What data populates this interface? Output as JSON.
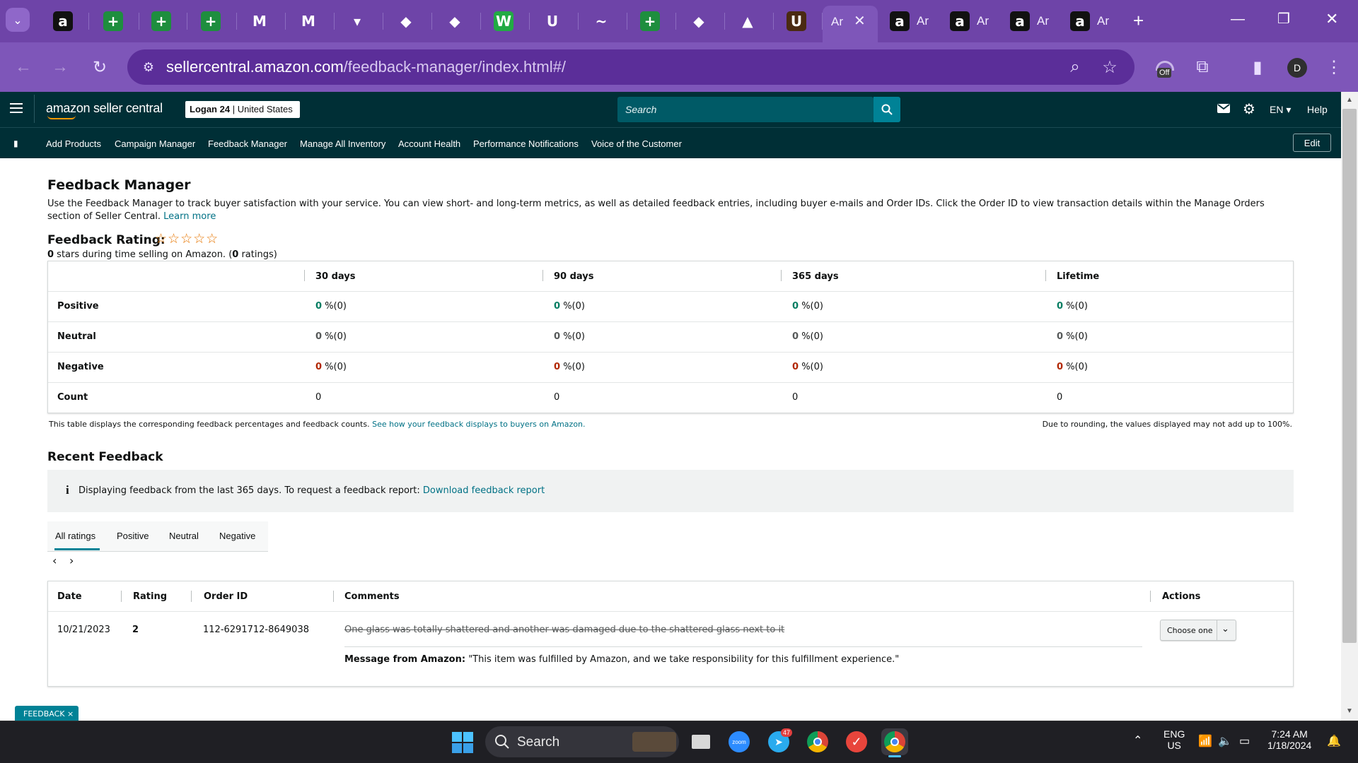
{
  "browser": {
    "tabs": [
      {
        "icon": "amazon-icon",
        "glyph": "a",
        "bg": "#111111"
      },
      {
        "icon": "sheets-plus-icon",
        "glyph": "+",
        "bg": "#1e8e3e"
      },
      {
        "icon": "sheets-plus-icon",
        "glyph": "+",
        "bg": "#1e8e3e"
      },
      {
        "icon": "sheets-plus-icon",
        "glyph": "+",
        "bg": "#1e8e3e"
      },
      {
        "icon": "gmail-icon",
        "glyph": "M",
        "bg": "#6e44a8"
      },
      {
        "icon": "gmail-icon",
        "glyph": "M",
        "bg": "#6e44a8"
      },
      {
        "icon": "site-icon",
        "glyph": "▾",
        "bg": "#6e44a8"
      },
      {
        "icon": "tool-icon",
        "glyph": "◆",
        "bg": "#6e44a8"
      },
      {
        "icon": "tool-icon",
        "glyph": "◆",
        "bg": "#6e44a8"
      },
      {
        "icon": "w-app-icon",
        "glyph": "W",
        "bg": "#22aa44"
      },
      {
        "icon": "uline-icon",
        "glyph": "U",
        "bg": "#6e44a8"
      },
      {
        "icon": "site-icon",
        "glyph": "~",
        "bg": "#6e44a8"
      },
      {
        "icon": "sheets-plus-icon",
        "glyph": "+",
        "bg": "#1e8e3e"
      },
      {
        "icon": "tool-icon",
        "glyph": "◆",
        "bg": "#6e44a8"
      },
      {
        "icon": "drive-icon",
        "glyph": "▲",
        "bg": "#6e44a8"
      },
      {
        "icon": "ups-icon",
        "glyph": "U",
        "bg": "#4a2a12"
      }
    ],
    "active_tab_label": "Ar",
    "extra_tabs": [
      {
        "glyph": "a",
        "label": "Ar"
      },
      {
        "glyph": "a",
        "label": "Ar"
      },
      {
        "glyph": "a",
        "label": "Ar"
      },
      {
        "glyph": "a",
        "label": "Ar"
      }
    ],
    "url_host": "sellercentral.amazon.com",
    "url_path": "/feedback-manager/index.html#/",
    "profile_initial": "D",
    "extension_badge": "Off"
  },
  "header": {
    "logo_text": "amazon seller central",
    "store": "Logan 24",
    "marketplace": "United States",
    "search_placeholder": "Search",
    "language": "EN",
    "help": "Help"
  },
  "nav": {
    "items": [
      "Add Products",
      "Campaign Manager",
      "Feedback Manager",
      "Manage All Inventory",
      "Account Health",
      "Performance Notifications",
      "Voice of the Customer"
    ],
    "edit": "Edit"
  },
  "page": {
    "title": "Feedback Manager",
    "description": "Use the Feedback Manager to track buyer satisfaction with your service. You can view short- and long-term metrics, as well as detailed feedback entries, including buyer e-mails and Order IDs. Click the Order ID to view transaction details within the Manage Orders section of Seller Central.",
    "learn_more": "Learn more",
    "rating_title": "Feedback Rating:",
    "stars": "☆☆☆☆☆",
    "rating_stars_value": "0",
    "rating_sub_mid": " stars during time selling on Amazon. (",
    "rating_count": "0",
    "rating_sub_end": " ratings)"
  },
  "metrics": {
    "columns": [
      "30 days",
      "90 days",
      "365 days",
      "Lifetime"
    ],
    "rows": [
      {
        "label": "Positive",
        "kind": "pos",
        "values": [
          "0",
          "0",
          "0",
          "0"
        ],
        "suffix": "%(0)"
      },
      {
        "label": "Neutral",
        "kind": "neu",
        "values": [
          "0",
          "0",
          "0",
          "0"
        ],
        "suffix": "%(0)"
      },
      {
        "label": "Negative",
        "kind": "neg",
        "values": [
          "0",
          "0",
          "0",
          "0"
        ],
        "suffix": "%(0)"
      },
      {
        "label": "Count",
        "kind": "count",
        "values": [
          "0",
          "0",
          "0",
          "0"
        ],
        "suffix": ""
      }
    ],
    "note": "This table displays the corresponding feedback percentages and feedback counts.",
    "note_link": "See how your feedback displays to buyers on Amazon.",
    "rounding": "Due to rounding, the values displayed may not add up to 100%."
  },
  "recent": {
    "title": "Recent Feedback",
    "info_icon": "i",
    "info_text": "Displaying feedback from the last 365 days. To request a feedback report:",
    "info_link": "Download feedback report",
    "tabs": [
      "All ratings",
      "Positive",
      "Neutral",
      "Negative"
    ],
    "columns": {
      "date": "Date",
      "rating": "Rating",
      "order": "Order ID",
      "comments": "Comments",
      "actions": "Actions"
    },
    "rows": [
      {
        "date": "10/21/2023",
        "rating": "2",
        "order_id": "112-6291712-8649038",
        "comment": "One glass was totally shattered and another was damaged due to the shattered glass next to it",
        "message_label": "Message from Amazon:",
        "message": "\"This item was fulfilled by Amazon, and we take responsibility for this fulfillment experience.\"",
        "action": "Choose one"
      }
    ]
  },
  "feedback_pill": "FEEDBACK ×",
  "taskbar": {
    "search": "Search",
    "telegram_badge": "47",
    "lang1": "ENG",
    "lang2": "US",
    "time": "7:24 AM",
    "date": "1/18/2024"
  },
  "colors": {
    "positive": "#067d62",
    "negative": "#b12704",
    "header": "#002f36",
    "link": "#007185",
    "browser": "#7e56b9"
  }
}
